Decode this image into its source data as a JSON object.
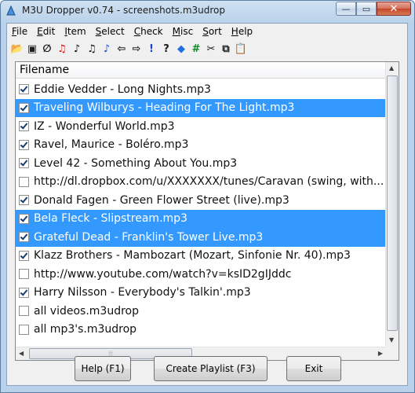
{
  "window": {
    "title": "M3U Dropper v0.74 - screenshots.m3udrop",
    "caption": {
      "minimize": "—",
      "maximize": "▭",
      "close": "✕"
    }
  },
  "menu": [
    {
      "first": "F",
      "rest": "ile"
    },
    {
      "first": "E",
      "rest": "dit"
    },
    {
      "first": "I",
      "rest": "tem"
    },
    {
      "first": "S",
      "rest": "elect"
    },
    {
      "first": "C",
      "rest": "heck"
    },
    {
      "first": "M",
      "rest": "isc"
    },
    {
      "first": "S",
      "rest": "ort"
    },
    {
      "first": "H",
      "rest": "elp"
    }
  ],
  "toolbar": [
    {
      "icon": "open-folder-icon",
      "glyph": "📂",
      "color": "#d4a017"
    },
    {
      "icon": "save-icon",
      "glyph": "▣",
      "color": "#1f1f1f"
    },
    {
      "icon": "clear-icon",
      "glyph": "∅",
      "color": "#111111"
    },
    {
      "icon": "music-note-red-icon",
      "glyph": "♫",
      "color": "#d01818"
    },
    {
      "icon": "music-note-icon",
      "glyph": "♪",
      "color": "#111111"
    },
    {
      "icon": "music-notes-icon",
      "glyph": "♫",
      "color": "#111111"
    },
    {
      "icon": "music-note-blue-icon",
      "glyph": "♪",
      "color": "#1c4ed8"
    },
    {
      "icon": "arrow-left-icon",
      "glyph": "⇦",
      "color": "#1a1a1a"
    },
    {
      "icon": "arrow-right-icon",
      "glyph": "⇨",
      "color": "#1a1a1a"
    },
    {
      "icon": "exclamation-icon",
      "glyph": "!",
      "color": "#1c3fc8"
    },
    {
      "icon": "question-icon",
      "glyph": "?",
      "color": "#1a1a1a"
    },
    {
      "icon": "diamond-icon",
      "glyph": "◆",
      "color": "#1f6fe0"
    },
    {
      "icon": "hash-icon",
      "glyph": "#",
      "color": "#128a2a"
    },
    {
      "icon": "scissors-icon",
      "glyph": "✂",
      "color": "#1a1a1a"
    },
    {
      "icon": "copy-icon",
      "glyph": "⧉",
      "color": "#1a1a1a"
    },
    {
      "icon": "paste-icon",
      "glyph": "📋",
      "color": "#8a6d2a"
    }
  ],
  "list": {
    "header": "Filename",
    "rows": [
      {
        "text": "Eddie Vedder - Long Nights.mp3",
        "checked": true,
        "selected": false
      },
      {
        "text": "Traveling Wilburys - Heading For The Light.mp3",
        "checked": true,
        "selected": true
      },
      {
        "text": "IZ - Wonderful World.mp3",
        "checked": true,
        "selected": false
      },
      {
        "text": "Ravel, Maurice - Boléro.mp3",
        "checked": true,
        "selected": false
      },
      {
        "text": "Level 42 - Something About You.mp3",
        "checked": true,
        "selected": false
      },
      {
        "text": "http://dl.dropbox.com/u/XXXXXXX/tunes/Caravan (swing, with...",
        "checked": false,
        "selected": false
      },
      {
        "text": "Donald Fagen - Green Flower Street (live).mp3",
        "checked": true,
        "selected": false
      },
      {
        "text": "Bela Fleck - Slipstream.mp3",
        "checked": true,
        "selected": true
      },
      {
        "text": "Grateful Dead - Franklin's Tower Live.mp3",
        "checked": true,
        "selected": true
      },
      {
        "text": "Klazz Brothers - Mambozart (Mozart, Sinfonie Nr. 40).mp3",
        "checked": true,
        "selected": false
      },
      {
        "text": "http://www.youtube.com/watch?v=ksID2gIJddc",
        "checked": false,
        "selected": false
      },
      {
        "text": "Harry Nilsson - Everybody's Talkin'.mp3",
        "checked": true,
        "selected": false
      },
      {
        "text": "all videos.m3udrop",
        "checked": false,
        "selected": false
      },
      {
        "text": "all mp3's.m3udrop",
        "checked": false,
        "selected": false
      }
    ]
  },
  "buttons": {
    "help": "Help (F1)",
    "create": "Create Playlist (F3)",
    "exit": "Exit"
  },
  "colors": {
    "selection": "#3399ff"
  }
}
